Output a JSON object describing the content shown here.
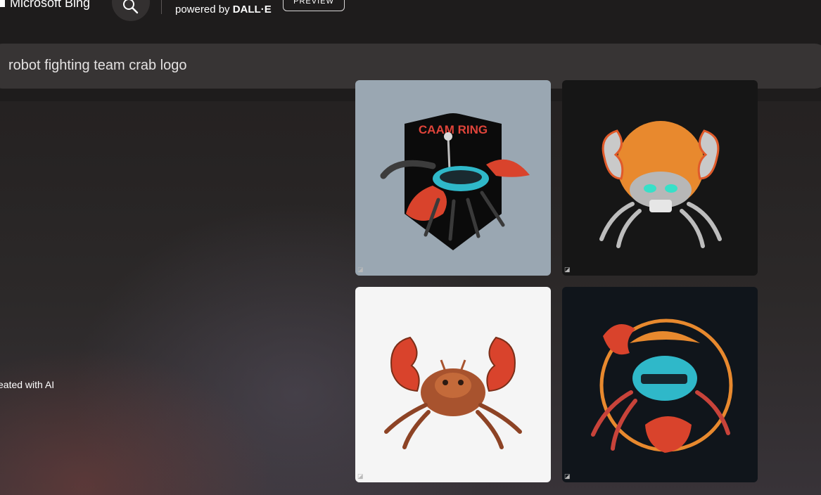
{
  "header": {
    "brand": "Microsoft Bing",
    "powered_prefix": "powered by ",
    "powered_brand": "DALL·E",
    "preview_label": "PREVIEW"
  },
  "prompt": {
    "value": "robot fighting team crab logo"
  },
  "sidebar": {
    "caption": "eated with AI"
  },
  "images": [
    {
      "text": "CAAM RING"
    },
    {
      "text": ""
    },
    {
      "text": ""
    },
    {
      "text": ""
    }
  ],
  "colors": {
    "header_bg": "#1e1c1c",
    "prompt_bg": "#373434",
    "crab_red": "#d9432c",
    "crab_orange": "#e8892e",
    "accent_cyan": "#2fb8c9"
  },
  "icons": {
    "search": "search-icon",
    "logo": "microsoft-logo-icon"
  }
}
